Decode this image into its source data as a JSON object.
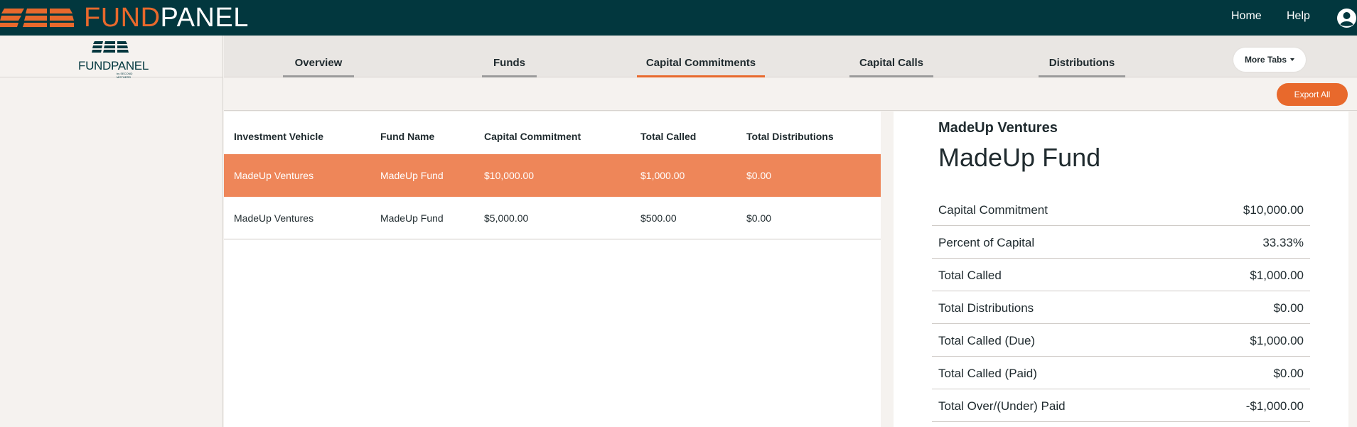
{
  "header": {
    "brand_fund": "FUND",
    "brand_panel": "PANEL",
    "nav": {
      "home": "Home",
      "help": "Help"
    }
  },
  "sidebar": {
    "logo_fund": "FUND",
    "logo_panel": "PANEL",
    "logo_sub": "by SECOND MOTHERS"
  },
  "tabs": [
    {
      "label": "Overview"
    },
    {
      "label": "Funds"
    },
    {
      "label": "Capital Commitments"
    },
    {
      "label": "Capital Calls"
    },
    {
      "label": "Distributions"
    }
  ],
  "more_tabs": "More Tabs",
  "toolbar": {
    "export": "Export All"
  },
  "table": {
    "headers": [
      "Investment Vehicle",
      "Fund Name",
      "Capital Commitment",
      "Total Called",
      "Total Distributions"
    ],
    "rows": [
      [
        "MadeUp Ventures",
        "MadeUp Fund",
        "$10,000.00",
        "$1,000.00",
        "$0.00"
      ],
      [
        "MadeUp Ventures",
        "MadeUp Fund",
        "$5,000.00",
        "$500.00",
        "$0.00"
      ]
    ]
  },
  "detail": {
    "vehicle": "MadeUp Ventures",
    "fund": "MadeUp Fund",
    "rows": [
      {
        "label": "Capital Commitment",
        "value": "$10,000.00"
      },
      {
        "label": "Percent of Capital",
        "value": "33.33%"
      },
      {
        "label": "Total Called",
        "value": "$1,000.00"
      },
      {
        "label": "Total Distributions",
        "value": "$0.00"
      },
      {
        "label": "Total Called (Due)",
        "value": "$1,000.00"
      },
      {
        "label": "Total Called (Paid)",
        "value": "$0.00"
      },
      {
        "label": "Total Over/(Under) Paid",
        "value": "-$1,000.00"
      }
    ]
  },
  "colors": {
    "topbar": "#02373e",
    "accent": "#e8692c",
    "selected_row": "#ee8659",
    "background": "#f5f2ef"
  }
}
